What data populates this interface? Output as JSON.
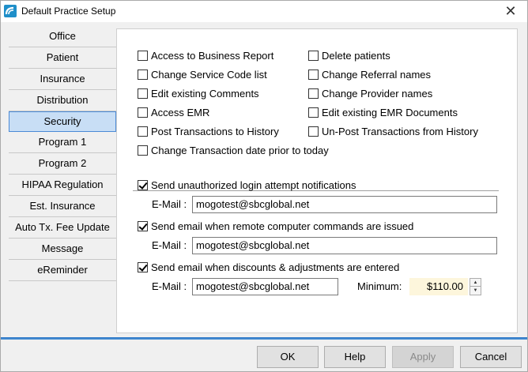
{
  "window": {
    "title": "Default Practice Setup",
    "close_glyph": "✕"
  },
  "sidebar": {
    "items": [
      {
        "label": "Office"
      },
      {
        "label": "Patient"
      },
      {
        "label": "Insurance"
      },
      {
        "label": "Distribution"
      },
      {
        "label": "Security",
        "selected": true
      },
      {
        "label": "Program 1"
      },
      {
        "label": "Program 2"
      },
      {
        "label": "HIPAA Regulation"
      },
      {
        "label": "Est. Insurance"
      },
      {
        "label": "Auto Tx. Fee Update"
      },
      {
        "label": "Message"
      },
      {
        "label": "eReminder"
      }
    ]
  },
  "permissions": {
    "access_business_report": {
      "label": "Access to Business Report",
      "checked": false
    },
    "delete_patients": {
      "label": "Delete patients",
      "checked": false
    },
    "change_service_code_list": {
      "label": "Change Service Code list",
      "checked": false
    },
    "change_referral_names": {
      "label": "Change Referral names",
      "checked": false
    },
    "edit_existing_comments": {
      "label": "Edit existing Comments",
      "checked": false
    },
    "change_provider_names": {
      "label": "Change Provider names",
      "checked": false
    },
    "access_emr": {
      "label": "Access EMR",
      "checked": false
    },
    "edit_existing_emr_documents": {
      "label": "Edit existing EMR Documents",
      "checked": false
    },
    "post_transactions": {
      "label": "Post Transactions to History",
      "checked": false
    },
    "unpost_transactions": {
      "label": "Un-Post Transactions from History",
      "checked": false
    },
    "change_transaction_date": {
      "label": "Change Transaction date prior to today",
      "checked": false
    }
  },
  "notifications": {
    "unauthorized_login": {
      "label": "Send unauthorized login attempt notifications",
      "checked": true,
      "email_label": "E-Mail :",
      "email": "mogotest@sbcglobal.net"
    },
    "remote_commands": {
      "label": "Send email when remote computer commands are issued",
      "checked": true,
      "email_label": "E-Mail :",
      "email": "mogotest@sbcglobal.net"
    },
    "discounts": {
      "label": "Send email when discounts & adjustments are entered",
      "checked": true,
      "email_label": "E-Mail :",
      "email": "mogotest@sbcglobal.net",
      "minimum_label": "Minimum:",
      "minimum_value": "$110.00"
    }
  },
  "buttons": {
    "ok": "OK",
    "help": "Help",
    "apply": "Apply",
    "cancel": "Cancel"
  },
  "colors": {
    "accent": "#1f8fc9",
    "selected_bg": "#c8def5",
    "minimum_bg": "#fdf6dc"
  },
  "icons": {
    "app": "app-logo-icon",
    "close": "close-icon",
    "spin_up": "spin-up-icon",
    "spin_down": "spin-down-icon"
  }
}
